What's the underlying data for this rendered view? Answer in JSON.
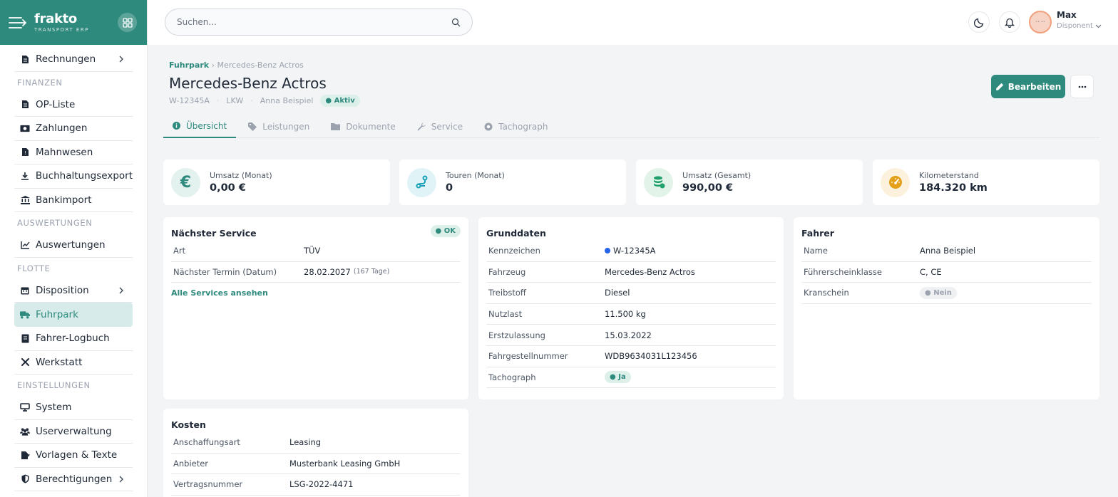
{
  "app": {
    "name": "frakto",
    "tagline": "TRANSPORT ERP"
  },
  "sidebar": {
    "items": [
      {
        "type": "item",
        "label": "Rechnungen",
        "icon": "invoice-icon",
        "chevron": true
      },
      {
        "type": "section",
        "label": "FINANZEN"
      },
      {
        "type": "item",
        "label": "OP-Liste",
        "icon": "document-icon"
      },
      {
        "type": "item",
        "label": "Zahlungen",
        "icon": "money-icon"
      },
      {
        "type": "item",
        "label": "Mahnwesen",
        "icon": "reminder-icon"
      },
      {
        "type": "item",
        "label": "Buchhaltungsexport",
        "icon": "download-icon"
      },
      {
        "type": "item",
        "label": "Bankimport",
        "icon": "bank-icon"
      },
      {
        "type": "section",
        "label": "AUSWERTUNGEN"
      },
      {
        "type": "item",
        "label": "Auswertungen",
        "icon": "chart-icon"
      },
      {
        "type": "section",
        "label": "FLOTTE"
      },
      {
        "type": "item",
        "label": "Disposition",
        "icon": "calendar-icon",
        "chevron": true
      },
      {
        "type": "item",
        "label": "Fuhrpark",
        "icon": "truck-icon",
        "active": true
      },
      {
        "type": "item",
        "label": "Fahrer-Logbuch",
        "icon": "book-icon"
      },
      {
        "type": "item",
        "label": "Werkstatt",
        "icon": "tools-icon"
      },
      {
        "type": "section",
        "label": "EINSTELLUNGEN"
      },
      {
        "type": "item",
        "label": "System",
        "icon": "monitor-icon"
      },
      {
        "type": "item",
        "label": "Userverwaltung",
        "icon": "users-icon"
      },
      {
        "type": "item",
        "label": "Vorlagen & Texte",
        "icon": "file-edit-icon"
      },
      {
        "type": "item",
        "label": "Berechtigungen",
        "icon": "shield-icon",
        "chevron": true
      }
    ]
  },
  "topbar": {
    "search_placeholder": "Suchen...",
    "user": {
      "name": "Max",
      "role": "Disponent"
    }
  },
  "page": {
    "breadcrumb_root": "Fuhrpark",
    "breadcrumb_sep": "›",
    "breadcrumb_current": "Mercedes-Benz Actros",
    "title": "Mercedes-Benz Actros",
    "meta": {
      "plate": "W-12345A",
      "type": "LKW",
      "driver": "Anna Beispiel",
      "status": "Aktiv",
      "sep": "·"
    },
    "edit_label": "Bearbeiten",
    "tabs": [
      {
        "label": "Übersicht",
        "icon": "info-icon",
        "active": true
      },
      {
        "label": "Leistungen",
        "icon": "tag-icon"
      },
      {
        "label": "Dokumente",
        "icon": "folder-icon"
      },
      {
        "label": "Service",
        "icon": "wrench-icon"
      },
      {
        "label": "Tachograph",
        "icon": "tachograph-icon"
      }
    ]
  },
  "kpis": [
    {
      "label": "Umsatz (Monat)",
      "value": "0,00 €",
      "icon": "euro-icon",
      "color": "#2f8a7e",
      "bg": "#e3f1ef"
    },
    {
      "label": "Touren (Monat)",
      "value": "0",
      "icon": "route-icon",
      "color": "#1aa3b8",
      "bg": "#e0f4f7"
    },
    {
      "label": "Umsatz (Gesamt)",
      "value": "990,00 €",
      "icon": "coins-icon",
      "color": "#22a06b",
      "bg": "#e2f4ea"
    },
    {
      "label": "Kilometerstand",
      "value": "184.320 km",
      "icon": "gauge-icon",
      "color": "#e5a01a",
      "bg": "#fcf1dc"
    }
  ],
  "service": {
    "title": "Nächster Service",
    "badge": "OK",
    "rows": [
      {
        "key": "Art",
        "value": "TÜV"
      },
      {
        "key": "Nächster Termin (Datum)",
        "value": "28.02.2027",
        "note": "(167 Tage)"
      }
    ],
    "link": "Alle Services ansehen"
  },
  "grunddaten": {
    "title": "Grunddaten",
    "rows": [
      {
        "key": "Kennzeichen",
        "value": "W-12345A"
      },
      {
        "key": "Fahrzeug",
        "value": "Mercedes-Benz Actros"
      },
      {
        "key": "Treibstoff",
        "value": "Diesel"
      },
      {
        "key": "Nutzlast",
        "value": "11.500 kg"
      },
      {
        "key": "Erstzulassung",
        "value": "15.03.2022"
      },
      {
        "key": "Fahrgestellnummer",
        "value": "WDB9634031L123456"
      },
      {
        "key": "Tachograph",
        "value": "Ja"
      }
    ]
  },
  "fahrer": {
    "title": "Fahrer",
    "rows": [
      {
        "key": "Name",
        "value": "Anna Beispiel"
      },
      {
        "key": "Führerscheinklasse",
        "value": "C, CE"
      },
      {
        "key": "Kranschein",
        "value": "Nein"
      }
    ]
  },
  "kosten": {
    "title": "Kosten",
    "rows": [
      {
        "key": "Anschaffungsart",
        "value": "Leasing"
      },
      {
        "key": "Anbieter",
        "value": "Musterbank Leasing GmbH"
      },
      {
        "key": "Vertragsnummer",
        "value": "LSG-2022-4471"
      }
    ]
  }
}
